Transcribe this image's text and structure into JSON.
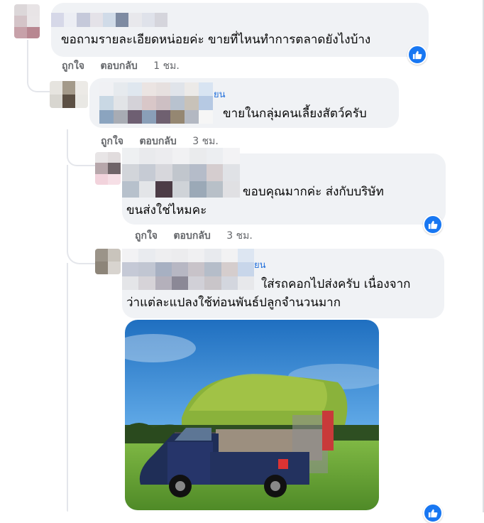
{
  "comments": [
    {
      "text_lines": [
        "ขอถามรายละเอียดหน่อยค่ะ ขายที่ไหนทำการตลาดยังไงบ้าง"
      ],
      "actions": {
        "like": "ถูกใจ",
        "reply": "ตอบกลับ",
        "time": "1 ชม."
      }
    },
    {
      "name_tag": "ยน",
      "text_lines": [
        "ขายในกลุ่มคนเลี้ยงสัตว์ครับ"
      ],
      "actions": {
        "like": "ถูกใจ",
        "reply": "ตอบกลับ",
        "time": "3 ชม."
      }
    },
    {
      "text_lines": [
        "ขอบคุณมากค่ะ ส่งกับบริษัท",
        "ขนส่งใช่ไหมคะ"
      ],
      "actions": {
        "like": "ถูกใจ",
        "reply": "ตอบกลับ",
        "time": "3 ชม."
      }
    },
    {
      "name_tag": "ยน",
      "text_lines": [
        "ใส่รถคอกไปส่งครับ เนื่องจาก",
        "ว่าแต่ละแปลงใช้ท่อนพันธ์ปลูกจำนวนมาก"
      ]
    }
  ],
  "icons": {
    "reaction": "like-icon"
  },
  "colors": {
    "bubble": "#f0f2f5",
    "meta": "#65676b",
    "link": "#216fdb",
    "like": "#1877f2"
  }
}
